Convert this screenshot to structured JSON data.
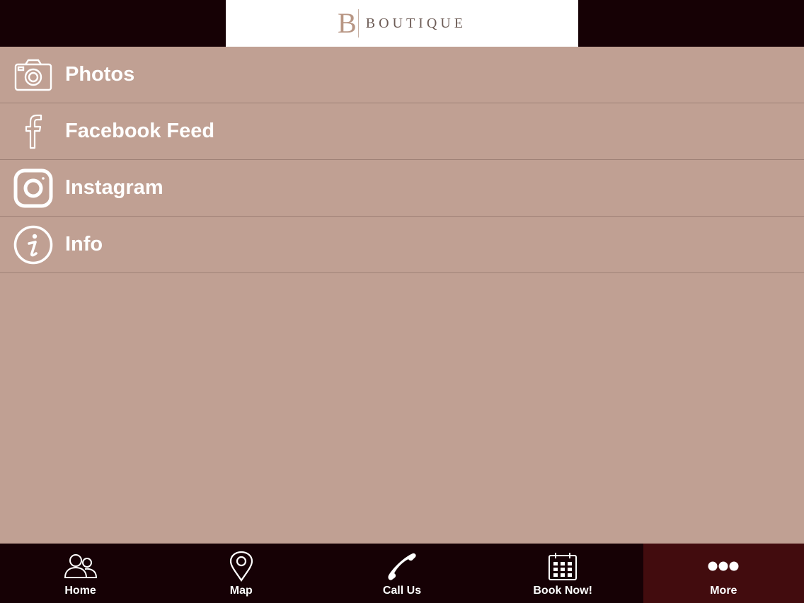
{
  "header": {
    "logo_mark": "B",
    "logo_text": "BOUTIQUE"
  },
  "menu": {
    "items": [
      {
        "label": "Photos",
        "icon": "camera-icon"
      },
      {
        "label": "Facebook Feed",
        "icon": "facebook-icon"
      },
      {
        "label": "Instagram",
        "icon": "instagram-icon"
      },
      {
        "label": "Info",
        "icon": "info-icon"
      }
    ]
  },
  "tabbar": {
    "tabs": [
      {
        "label": "Home",
        "icon": "people-icon"
      },
      {
        "label": "Map",
        "icon": "map-pin-icon"
      },
      {
        "label": "Call Us",
        "icon": "phone-icon"
      },
      {
        "label": "Book Now!",
        "icon": "calendar-icon"
      },
      {
        "label": "More",
        "icon": "more-dots-icon",
        "active": true
      }
    ]
  },
  "colors": {
    "background": "#c0a093",
    "bar": "#160105",
    "active_tab": "#420c0e",
    "text": "#ffffff"
  }
}
